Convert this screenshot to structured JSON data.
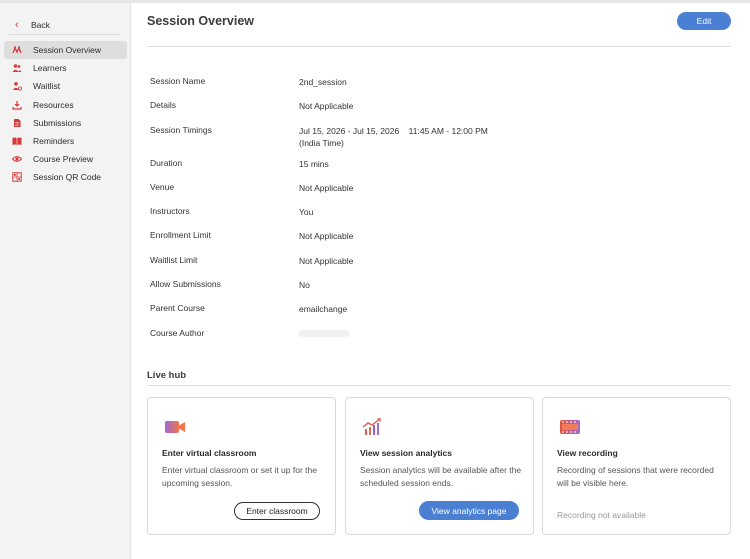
{
  "sidebar": {
    "back_label": "Back",
    "items": [
      {
        "label": "Session Overview",
        "icon": "session-overview-icon",
        "active": true
      },
      {
        "label": "Learners",
        "icon": "learners-icon"
      },
      {
        "label": "Waitlist",
        "icon": "waitlist-icon"
      },
      {
        "label": "Resources",
        "icon": "download-icon"
      },
      {
        "label": "Submissions",
        "icon": "document-icon"
      },
      {
        "label": "Reminders",
        "icon": "book-icon"
      },
      {
        "label": "Course Preview",
        "icon": "eye-icon"
      },
      {
        "label": "Session QR Code",
        "icon": "qr-code-icon"
      }
    ]
  },
  "header": {
    "title": "Session Overview",
    "edit_label": "Edit"
  },
  "details": [
    {
      "key": "Session Name",
      "value": "2nd_session"
    },
    {
      "key": "Details",
      "value": "Not Applicable"
    },
    {
      "key": "Session Timings",
      "value": "Jul 15, 2026 - Jul 15, 2026    11:45 AM - 12:00 PM",
      "value2": "(India Time)"
    },
    {
      "key": "Duration",
      "value": "15 mins"
    },
    {
      "key": "Venue",
      "value": "Not Applicable"
    },
    {
      "key": "Instructors",
      "value": "You"
    },
    {
      "key": "Enrollment Limit",
      "value": "Not Applicable"
    },
    {
      "key": "Waitlist Limit",
      "value": "Not Applicable"
    },
    {
      "key": "Allow Submissions",
      "value": "No"
    },
    {
      "key": "Parent Course",
      "value": "emailchange"
    },
    {
      "key": "Course Author",
      "value": ""
    }
  ],
  "live_hub": {
    "title": "Live hub",
    "cards": [
      {
        "icon": "video-camera-icon",
        "title": "Enter virtual classroom",
        "desc": "Enter virtual classroom or set it up for the upcoming session.",
        "button": "Enter classroom"
      },
      {
        "icon": "analytics-chart-icon",
        "title": "View session analytics",
        "desc": "Session analytics will be available after the scheduled session ends.",
        "button": "View analytics page"
      },
      {
        "icon": "film-recording-icon",
        "title": "View recording",
        "desc": "Recording of sessions that were recorded will be visible here.",
        "status": "Recording not available"
      }
    ]
  },
  "colors": {
    "accent": "#4a7fd4",
    "icon_red": "#d63a3a",
    "sidebar_bg": "#f3f3f3"
  }
}
